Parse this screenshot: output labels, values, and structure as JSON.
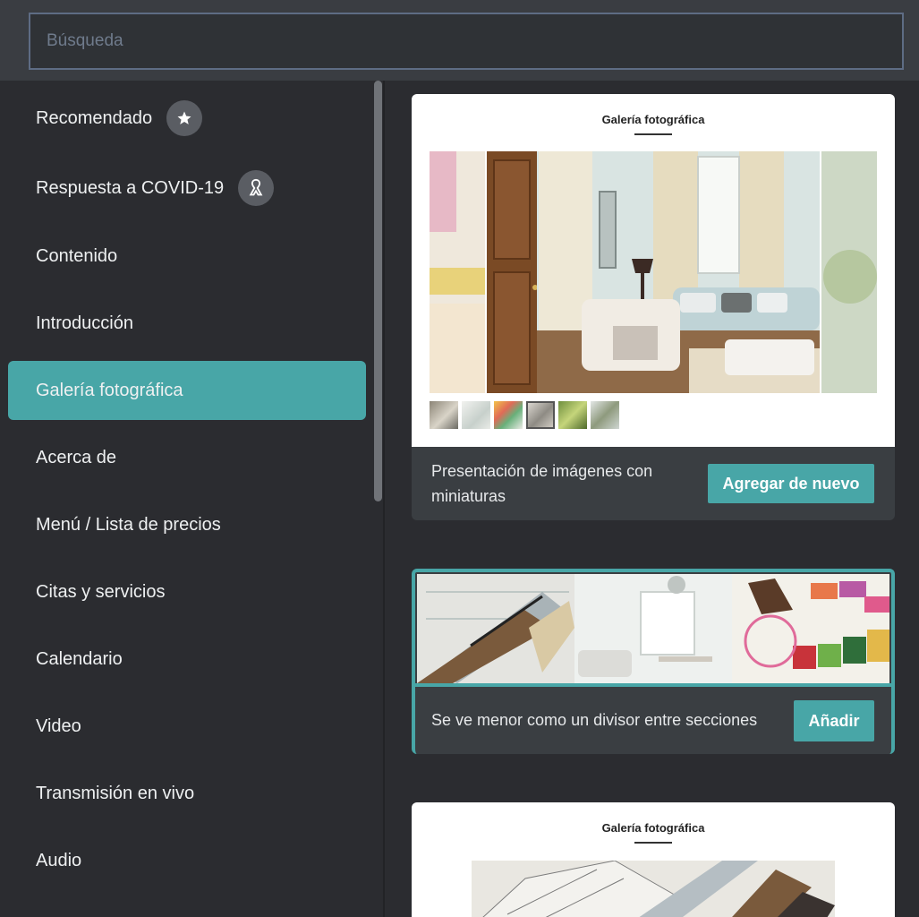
{
  "search": {
    "placeholder": "Búsqueda"
  },
  "sidebar": {
    "items": [
      {
        "label": "Recomendado"
      },
      {
        "label": "Respuesta a COVID-19"
      },
      {
        "label": "Contenido"
      },
      {
        "label": "Introducción"
      },
      {
        "label": "Galería fotográfica"
      },
      {
        "label": "Acerca de"
      },
      {
        "label": "Menú / Lista de precios"
      },
      {
        "label": "Citas y servicios"
      },
      {
        "label": "Calendario"
      },
      {
        "label": "Video"
      },
      {
        "label": "Transmisión en vivo"
      },
      {
        "label": "Audio"
      }
    ],
    "active_item": "Galería fotográfica"
  },
  "cards": [
    {
      "preview_title": "Galería fotográfica",
      "description": "Presentación de imágenes con miniaturas",
      "button_label": "Agregar de nuevo"
    },
    {
      "description": "Se ve menor como un divisor entre secciones",
      "button_label": "Añadir"
    },
    {
      "preview_title": "Galería fotográfica"
    }
  ],
  "colors": {
    "accent": "#48a6a7",
    "background": "#2b2c30",
    "card_footer": "#3a3e42"
  }
}
